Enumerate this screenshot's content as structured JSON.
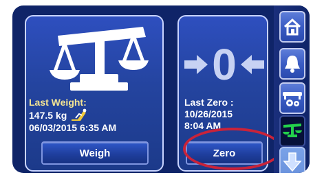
{
  "weigh_panel": {
    "last_label": "Last Weight:",
    "weight": "147.5 kg",
    "datetime": "06/03/2015  6:35  AM",
    "button_label": "Weigh"
  },
  "zero_panel": {
    "zero_digit": "0",
    "last_label": "Last Zero :",
    "date": "10/26/2015",
    "time": "8:04  AM",
    "button_label": "Zero"
  },
  "sidebar": {
    "items": [
      "home-icon",
      "bell-icon",
      "bed-settings-icon",
      "scale-icon",
      "down-arrow-icon"
    ]
  },
  "colors": {
    "panel": "#2e4fbf",
    "highlight": "#c9233a",
    "active_scale": "#23d04b"
  }
}
